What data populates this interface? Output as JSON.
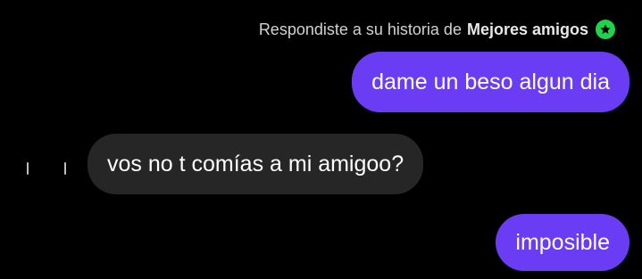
{
  "reply_context": {
    "prefix": "Respondiste a su historia de",
    "list_name": "Mejores amigos",
    "badge_icon": "star-icon",
    "badge_color": "#1fd34a"
  },
  "messages": [
    {
      "id": "msg-1",
      "direction": "sent",
      "text": "dame un beso algun dia"
    },
    {
      "id": "msg-2",
      "direction": "received",
      "text": "vos no t comías a mi amigoo?"
    },
    {
      "id": "msg-3",
      "direction": "sent",
      "text": "imposible"
    }
  ],
  "colors": {
    "background": "#000000",
    "sent_bubble": "#6a3cf4",
    "received_bubble": "#262626",
    "context_text": "#d2d2d2"
  }
}
